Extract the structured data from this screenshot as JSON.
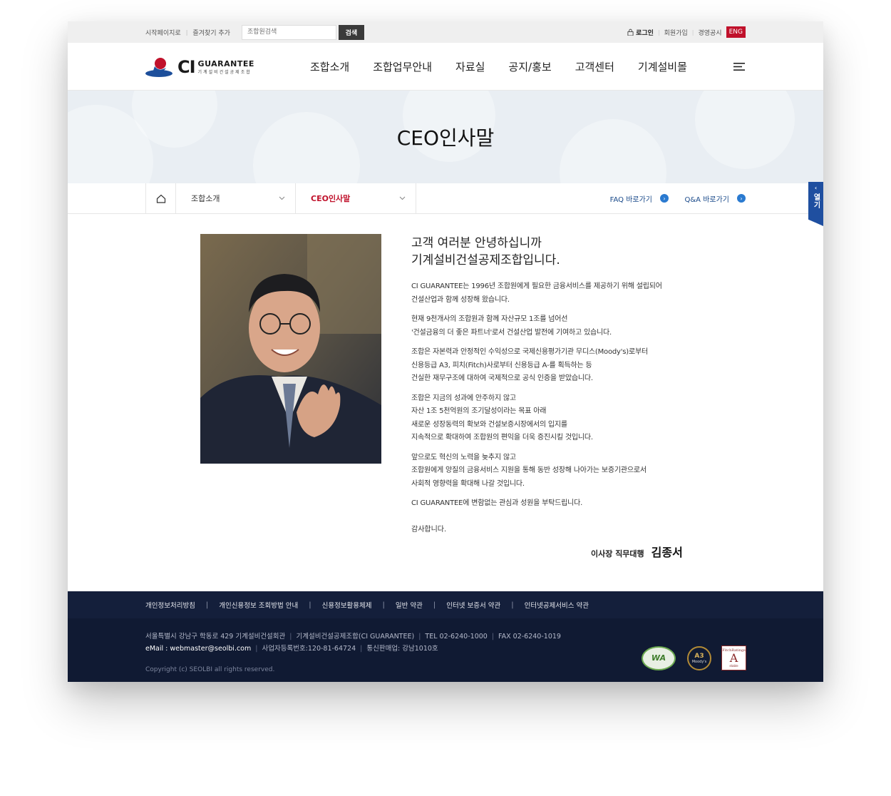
{
  "utilbar": {
    "start_page": "시작페이지로",
    "bookmark": "즐겨찾기 추가",
    "search_placeholder": "조합원검색",
    "search_button": "검색",
    "login": "로그인",
    "join": "회원가입",
    "disclosure": "경영공시",
    "eng": "ENG"
  },
  "header": {
    "logo_ci": "CI",
    "logo_guarantee": "GUARANTEE",
    "logo_sub": "기계설비건설공제조합",
    "nav": [
      "조합소개",
      "조합업무안내",
      "자료실",
      "공지/홍보",
      "고객센터",
      "기계설비몰"
    ],
    "menu_icon": "hamburger-icon"
  },
  "banner": {
    "title": "CEO인사말"
  },
  "breadcrumb": {
    "level1": "조합소개",
    "level2": "CEO인사말",
    "faq_link": "FAQ 바로가기",
    "qna_link": "Q&A 바로가기"
  },
  "side_tab": {
    "label": "열기",
    "arrow": "‹"
  },
  "content": {
    "headline1": "고객 여러분 안녕하십니까",
    "headline2": "기계설비건설공제조합입니다.",
    "paragraphs": [
      [
        "CI GUARANTEE는 1996년 조합원에게 필요한 금융서비스를 제공하기 위해 설립되어",
        "건설산업과 함께 성장해 왔습니다."
      ],
      [
        "현재 9천개사의 조합원과 함께 자산규모 1조를 넘어선",
        "'건설금융의 더 좋은 파트너'로서 건설산업 발전에 기여하고 있습니다."
      ],
      [
        "조합은 자본력과 안정적인 수익성으로 국제신용평가기관 무디스(Moody's)로부터",
        "신용등급 A3, 피치(Fitch)사로부터 신용등급 A-를 획득하는 등",
        "건실한 재무구조에 대하여 국제적으로 공식 인증을 받았습니다."
      ],
      [
        "조합은 지금의 성과에 안주하지 않고",
        "자산 1조 5천억원의 조기달성이라는 목표 아래",
        "새로운 성장동력의 확보와 건설보증시장에서의 입지를",
        "지속적으로 확대하여 조합원의 편익을 더욱 증진시킬 것입니다."
      ],
      [
        "앞으로도 혁신의 노력을 늦추지 않고",
        "조합원에게 양질의 금융서비스 지원을 통해 동반 성장해 나아가는 보증기관으로서",
        "사회적 영향력을 확대해 나갈 것입니다."
      ],
      [
        "CI GUARANTEE에 변함없는 관심과 성원을 부탁드립니다."
      ]
    ],
    "thanks": "감사합니다.",
    "sign_title": "이사장 직무대행",
    "sign_name": "김종서"
  },
  "footer": {
    "links": [
      "개인정보처리방침",
      "개인신용정보 조회방법 안내",
      "신용정보활용체제",
      "일반 약관",
      "인터넷 보증서 약관",
      "인터넷공제서비스 약관"
    ],
    "link_sep": "|",
    "address": "서울특별시 강남구 학동로 429 기계설비건설회관",
    "org": "기계설비건설공제조합(CI GUARANTEE)",
    "tel": "TEL 02-6240-1000",
    "fax": "FAX 02-6240-1019",
    "email": "eMail : webmaster@seolbi.com",
    "biz_no": "사업자등록번호:120-81-64724",
    "mail_order": "통신판매업: 강남1010호",
    "copyright": "Copyright (c) SEOLBI all rights reserved.",
    "badge_wa": "WA",
    "badge_moodys_grade": "A3",
    "badge_moodys_name": "Moody's",
    "badge_fitch_name": "FitchRatings",
    "badge_fitch_grade": "A",
    "badge_fitch_sub": "stable"
  },
  "colors": {
    "accent_red": "#c0112b",
    "footer_navy": "#101a33",
    "link_blue": "#1a4a8a"
  }
}
